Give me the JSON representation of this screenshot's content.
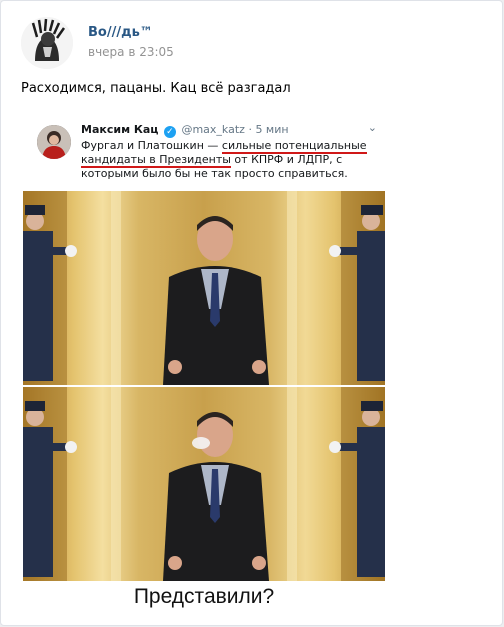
{
  "post": {
    "author": "Bo///дь™",
    "time": "вчера в 23:05",
    "text": "Расходимся, пацаны. Кац всё разгадал"
  },
  "tweet": {
    "name": "Максим Кац",
    "handle": "@max_katz",
    "separator": "·",
    "when": "5 мин",
    "text_before": "Фургал и Платошкин — ",
    "text_underlined": "сильные потенциальные кандидаты в Президенты",
    "text_after": " от КПРФ и ЛДПР, с которыми было бы не так просто справиться."
  },
  "caption": "Представили?",
  "icons": [
    "avatar-icon",
    "verified-icon",
    "chevron-down-icon"
  ],
  "colors": {
    "author_link": "#2a5885",
    "timestamp": "#939393",
    "verified": "#1da1f2",
    "underline": "#d01818"
  }
}
